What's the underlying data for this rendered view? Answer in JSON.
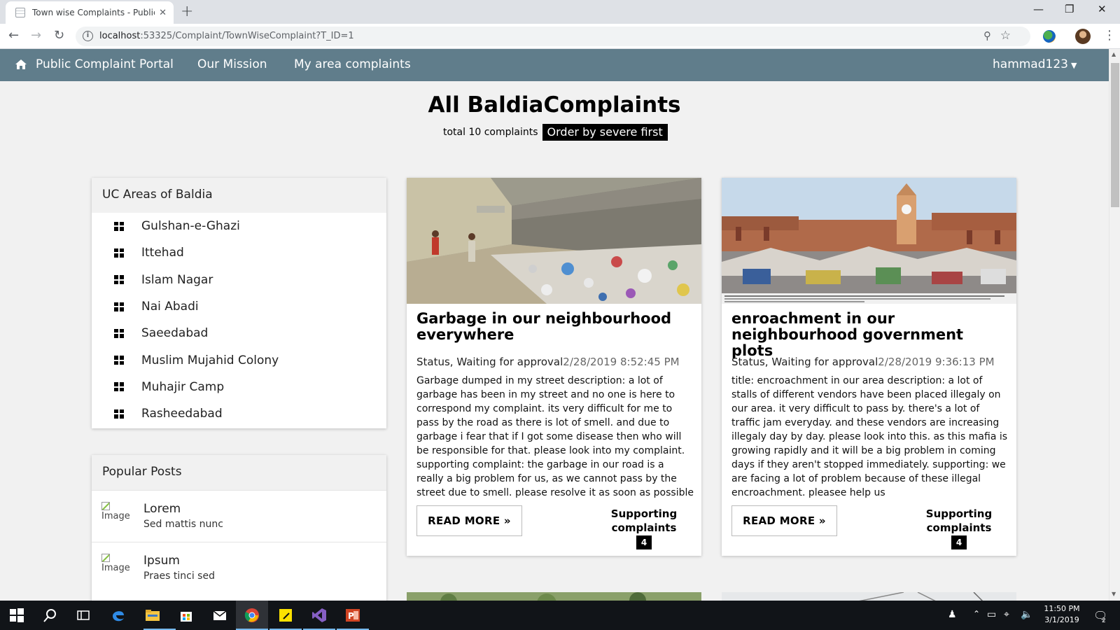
{
  "browser": {
    "tab_title": "Town wise Complaints - Public Co",
    "url_host": "localhost",
    "url_rest": ":53325/Complaint/TownWiseComplaint?T_ID=1",
    "new_tab": "+",
    "close": "✕",
    "minimize": "—",
    "restore": "❐",
    "window_close": "✕"
  },
  "navbar": {
    "brand": "Public Complaint Portal",
    "mission": "Our Mission",
    "my_area": "My area complaints",
    "user": "hammad123",
    "bg_color": "#607d8b"
  },
  "header": {
    "title": "All BaldiaComplaints",
    "total": "total 10 complaints",
    "order_button": "Order by severe first"
  },
  "sidebar": {
    "uc_title": "UC Areas of Baldia",
    "uc_items": [
      {
        "label": "Gulshan-e-Ghazi"
      },
      {
        "label": "Ittehad"
      },
      {
        "label": "Islam Nagar"
      },
      {
        "label": "Nai Abadi"
      },
      {
        "label": "Saeedabad"
      },
      {
        "label": "Muslim Mujahid Colony"
      },
      {
        "label": "Muhajir Camp"
      },
      {
        "label": "Rasheedabad"
      }
    ],
    "popular_title": "Popular Posts",
    "posts": [
      {
        "img_alt": "Image",
        "title": "Lorem",
        "sub": "Sed mattis nunc"
      },
      {
        "img_alt": "Image",
        "title": "Ipsum",
        "sub": "Praes tinci sed"
      }
    ]
  },
  "complaints": [
    {
      "title": "Garbage in our neighbourhood everywhere",
      "status": "Status, Waiting for approval",
      "date": "2/28/2019 8:52:45 PM",
      "description": "Garbage dumped in my street description: a lot of garbage has been in my street and no one is here to correspond my complaint. its very difficult for me to pass by the road as there is lot of smell. and due to garbage i fear that if I got some disease then who will be responsible for that. please look into my complaint. supporting complaint: the garbage in our road is a really a big problem for us, as we cannot pass by the street due to smell. please resolve it as soon as possible",
      "read_more": "READ MORE »",
      "support_label": "Supporting complaints",
      "support_count": "4"
    },
    {
      "title": "enroachment in our neighbourhood government plots",
      "status": "Status, Waiting for approval",
      "date": "2/28/2019 9:36:13 PM",
      "description": "title: encroachment in our area description: a lot of stalls of different vendors have been placed illegaly on our area. it very difficult to pass by. there's a lot of traffic jam everyday. and these vendors are increasing illegaly day by day. please look into this. as this mafia is growing rapidly and it will be a big problem in coming days if they aren't stopped immediately. supporting: we are facing a lot of problem because of these illegal encroachment. pleasee help us",
      "read_more": "READ MORE »",
      "support_label": "Supporting complaints",
      "support_count": "4"
    }
  ],
  "taskbar": {
    "time": "11:50 PM",
    "date": "3/1/2019",
    "notification_count": "2"
  }
}
